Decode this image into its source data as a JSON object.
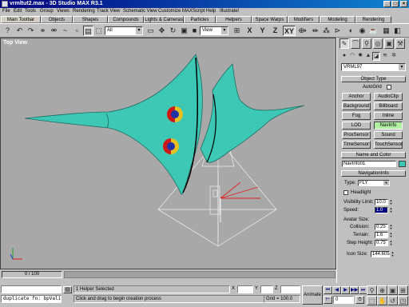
{
  "window": {
    "title": "vrmltut2.max - 3D Studio MAX R3.1"
  },
  "menu": [
    "File",
    "Edit",
    "Tools",
    "Group",
    "Views",
    "Rendering",
    "Track View",
    "Schematic View",
    "Customize",
    "MAXScript",
    "Help",
    "Illustrate!"
  ],
  "tabs": [
    "Main Toolbar",
    "Objects",
    "Shapes",
    "Compounds",
    "Lights & Cameras",
    "Particles",
    "Helpers",
    "Space Warps",
    "Modifiers",
    "Modeling",
    "Rendering"
  ],
  "toolbar": {
    "selection_filter": "All",
    "ref_coord": "View",
    "axis_labels": [
      "X",
      "Y",
      "Z",
      "XY"
    ]
  },
  "viewport": {
    "label": "Top View"
  },
  "command_panel": {
    "category": "VRML97",
    "object_type_title": "Object Type",
    "autogrid_label": "AutoGrid",
    "buttons": [
      "Anchor",
      "AudioClip",
      "Background",
      "Billboard",
      "Fog",
      "Inline",
      "LOD",
      "NavInfo",
      "ProxSensor",
      "Sound",
      "TimeSensor",
      "TouchSensor"
    ],
    "active_button": "NavInfo",
    "name_color_title": "Name and Color",
    "name_value": "NavInfo01",
    "navinfo_title": "NavigationInfo",
    "type_label": "Type:",
    "type_value": "FLY",
    "headlight_label": "Headlight",
    "visibility_label": "Visibility Limit:",
    "visibility_value": "10.0",
    "speed_label": "Speed:",
    "speed_value": "1.0",
    "avatar_label": "Avatar Size:",
    "collision_label": "Collision:",
    "collision_value": "0.25",
    "terrain_label": "Terrain:",
    "terrain_value": "1.6",
    "step_label": "Step Height:",
    "step_value": "0.75",
    "icon_size_label": "Icon Size:",
    "icon_size_value": "144.605"
  },
  "status": {
    "frame_slider": "0 / 100",
    "selection_text": "1 Helper Selected",
    "prompt_text": "Click and drag to begin creation process",
    "grid_text": "Grid = 100.0",
    "animate_label": "Animate",
    "listener_text": "duplicate fn: bpVali-",
    "frame_value": "0",
    "x_label": "X",
    "y_label": "Y",
    "z_label": "Z"
  },
  "colors": {
    "title_start": "#000080",
    "title_end": "#1084d0",
    "object": "#3cc8b4",
    "viewport_bg": "#a8a8a8"
  }
}
